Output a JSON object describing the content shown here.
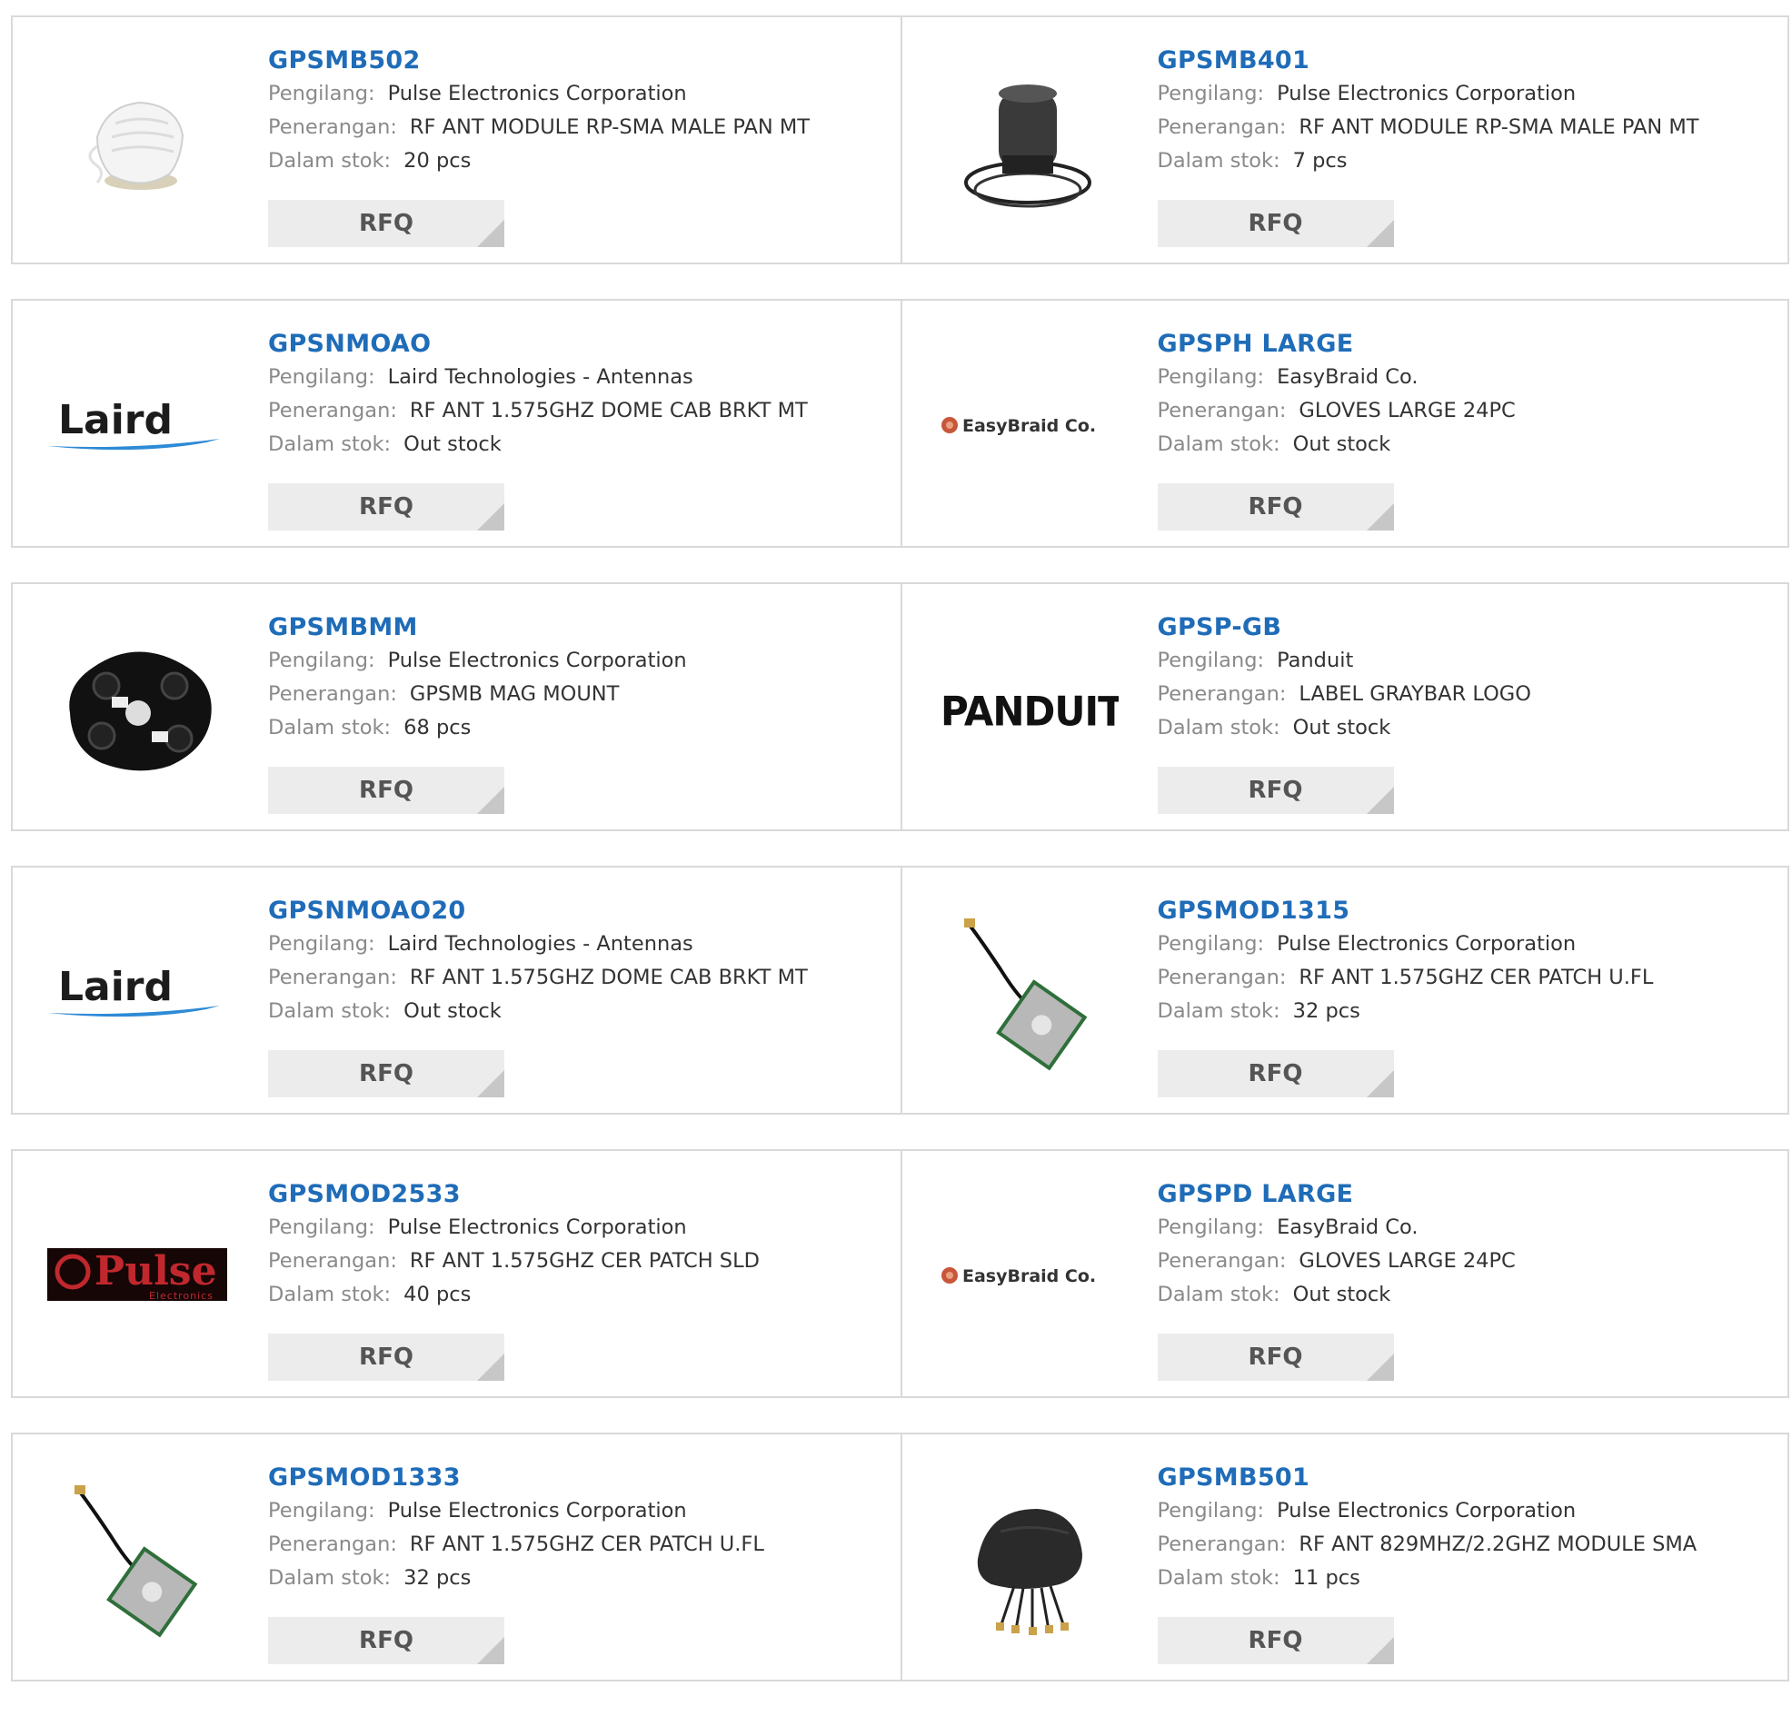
{
  "labels": {
    "manufacturer": "Pengilang:",
    "description": "Penerangan:",
    "stock": "Dalam stok:",
    "rfq": "RFQ"
  },
  "products": [
    {
      "part": "GPSMB502",
      "manufacturer": "Pulse Electronics Corporation",
      "description": "RF ANT MODULE RP-SMA MALE PAN MT",
      "stock": "20 pcs",
      "image": "white-dome-antenna"
    },
    {
      "part": "GPSMB401",
      "manufacturer": "Pulse Electronics Corporation",
      "description": "RF ANT MODULE RP-SMA MALE PAN MT",
      "stock": "7 pcs",
      "image": "black-puck-antenna"
    },
    {
      "part": "GPSNMOAO",
      "manufacturer": "Laird Technologies - Antennas",
      "description": "RF ANT 1.575GHZ DOME CAB BRKT MT",
      "stock": "Out stock",
      "image": "laird-logo"
    },
    {
      "part": "GPSPH LARGE",
      "manufacturer": "EasyBraid Co.",
      "description": "GLOVES LARGE 24PC",
      "stock": "Out stock",
      "image": "easybraid-logo"
    },
    {
      "part": "GPSMBMM",
      "manufacturer": "Pulse Electronics Corporation",
      "description": "GPSMB MAG MOUNT",
      "stock": "68 pcs",
      "image": "mag-mount"
    },
    {
      "part": "GPSP-GB",
      "manufacturer": "Panduit",
      "description": "LABEL GRAYBAR LOGO",
      "stock": "Out stock",
      "image": "panduit-logo"
    },
    {
      "part": "GPSNMOAO20",
      "manufacturer": "Laird Technologies - Antennas",
      "description": "RF ANT 1.575GHZ DOME CAB BRKT MT",
      "stock": "Out stock",
      "image": "laird-logo"
    },
    {
      "part": "GPSMOD1315",
      "manufacturer": "Pulse Electronics Corporation",
      "description": "RF ANT 1.575GHZ CER PATCH U.FL",
      "stock": "32 pcs",
      "image": "patch-antenna"
    },
    {
      "part": "GPSMOD2533",
      "manufacturer": "Pulse Electronics Corporation",
      "description": "RF ANT 1.575GHZ CER PATCH SLD",
      "stock": "40 pcs",
      "image": "pulse-logo"
    },
    {
      "part": "GPSPD LARGE",
      "manufacturer": "EasyBraid Co.",
      "description": "GLOVES LARGE 24PC",
      "stock": "Out stock",
      "image": "easybraid-logo"
    },
    {
      "part": "GPSMOD1333",
      "manufacturer": "Pulse Electronics Corporation",
      "description": "RF ANT 1.575GHZ CER PATCH U.FL",
      "stock": "32 pcs",
      "image": "patch-antenna"
    },
    {
      "part": "GPSMB501",
      "manufacturer": "Pulse Electronics Corporation",
      "description": "RF ANT 829MHZ/2.2GHZ MODULE SMA",
      "stock": "11 pcs",
      "image": "shark-fin-antenna"
    }
  ],
  "logos": {
    "laird": "Laird",
    "easybraid": "EasyBraid Co.",
    "panduit": "PANDUIT",
    "pulse": "Pulse",
    "pulse_sub": "Electronics"
  },
  "colors": {
    "link": "#1f6cb8",
    "label": "#8a8a8a",
    "border": "#d9d9d9",
    "button_bg": "#ececec"
  }
}
